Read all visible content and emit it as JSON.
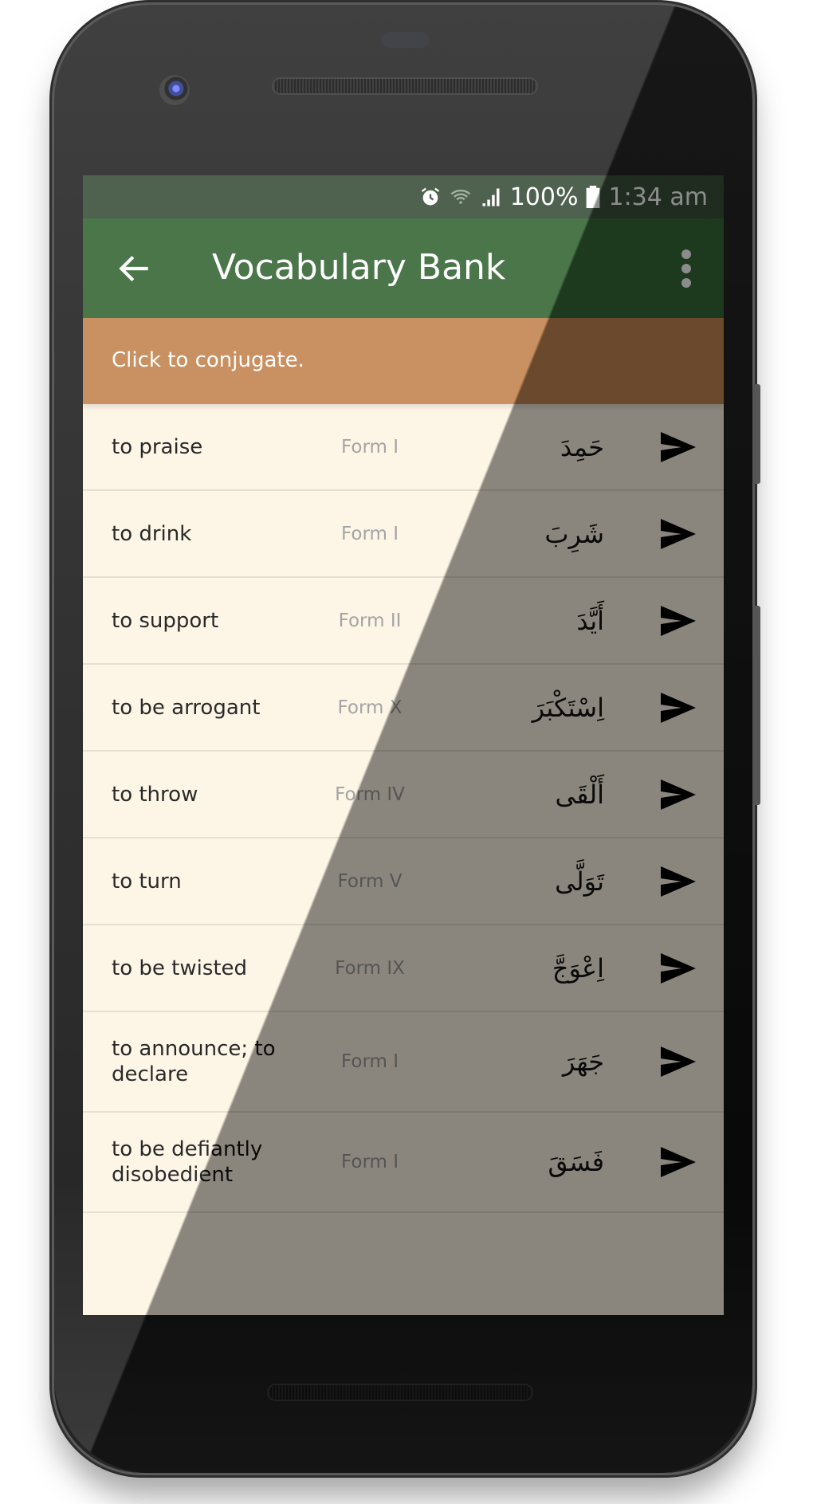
{
  "status_bar": {
    "icons": [
      "alarm-icon",
      "wifi-icon",
      "signal-icon",
      "battery-icon"
    ],
    "battery": "100%",
    "time": "1:34 am"
  },
  "toolbar": {
    "back_icon": "arrow-left-icon",
    "title": "Vocabulary Bank",
    "menu_icon": "more-vert-icon"
  },
  "banner": {
    "text": "Click to conjugate."
  },
  "colors": {
    "status_bar": "#3b4f3b",
    "toolbar": "#356736",
    "banner": "#c38550",
    "list_background": "#fdf4e3",
    "form_text": "#9a9a9a"
  },
  "verbs": [
    {
      "english": "to praise",
      "form": "Form I",
      "arabic": "حَمِدَ"
    },
    {
      "english": "to drink",
      "form": "Form I",
      "arabic": "شَرِبَ"
    },
    {
      "english": "to support",
      "form": "Form II",
      "arabic": "أَيَّدَ"
    },
    {
      "english": "to be arrogant",
      "form": "Form X",
      "arabic": "اِسْتَكْبَرَ"
    },
    {
      "english": "to throw",
      "form": "Form IV",
      "arabic": "أَلْقَى"
    },
    {
      "english": "to turn",
      "form": "Form V",
      "arabic": "تَوَلَّى"
    },
    {
      "english": "to be twisted",
      "form": "Form IX",
      "arabic": "اِعْوَجَّ"
    },
    {
      "english": "to announce; to declare",
      "form": "Form I",
      "arabic": "جَهَرَ"
    },
    {
      "english": "to be defiantly disobedient",
      "form": "Form I",
      "arabic": "فَسَقَ"
    }
  ]
}
